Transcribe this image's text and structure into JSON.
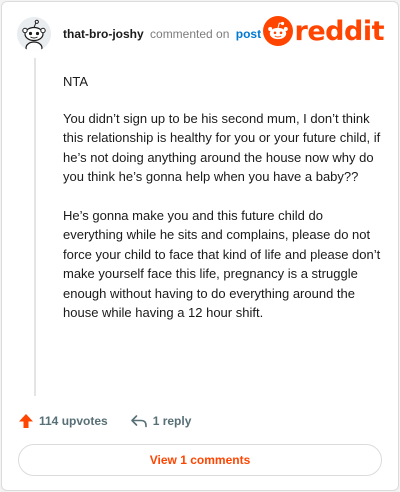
{
  "comment": {
    "username": "that-bro-joshy",
    "commented_on": "commented on",
    "post_link": "post",
    "paragraphs": [
      "NTA",
      "You didn’t sign up to be his second mum, I don’t think this relationship is healthy for you or your future child, if he’s not doing anything around the house now why do you think he’s gonna help when you have a baby??",
      "He’s gonna make you and this future child do everything while he sits and complains, please do not force your child to face that kind of life and please don’t make yourself face this life, pregnancy is a struggle enough without having to do everything around the house while having a 12 hour shift."
    ]
  },
  "brand": {
    "wordmark": "reddit",
    "color": "#ff4500"
  },
  "actions": {
    "upvotes_label": "114 upvotes",
    "replies_label": "1 reply",
    "view_comments_label": "View 1 comments"
  },
  "icons": {
    "avatar": "snoo-avatar-icon",
    "logo": "reddit-snoo-icon",
    "upvote": "upvote-arrow-icon",
    "reply": "reply-arrow-icon"
  }
}
